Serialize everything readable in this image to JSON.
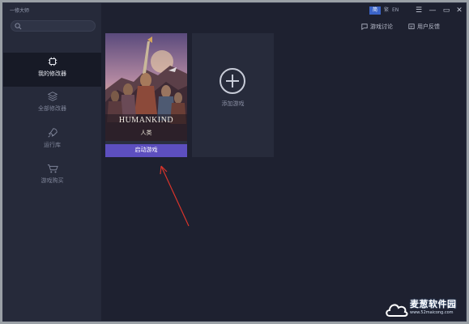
{
  "window": {
    "app_title": "一修大师"
  },
  "titlebar": {
    "lang_simplified": "简",
    "lang_traditional": "繁",
    "lang_english": "EN"
  },
  "header_links": [
    {
      "label": "游戏讨论",
      "icon": "chat-icon"
    },
    {
      "label": "用户反馈",
      "icon": "feedback-icon"
    }
  ],
  "sidebar": {
    "search_placeholder": "",
    "items": [
      {
        "label": "我的修改器",
        "icon": "chip-icon",
        "active": true
      },
      {
        "label": "全部修改器",
        "icon": "layers-icon",
        "active": false
      },
      {
        "label": "运行库",
        "icon": "rocket-icon",
        "active": false
      },
      {
        "label": "游戏购买",
        "icon": "cart-icon",
        "active": false
      }
    ]
  },
  "games": [
    {
      "cover_title": "HUMANKIND",
      "cover_subtitle": "人类",
      "button_label": "启动游戏"
    }
  ],
  "add_game": {
    "label": "添加游戏"
  },
  "watermark": {
    "text": "麦葱软件园",
    "url": "www.52maicong.com"
  },
  "colors": {
    "accent": "#5d4fbf",
    "background": "#1e2130",
    "sidebar": "#262a3a",
    "arrow": "#d9342b"
  }
}
